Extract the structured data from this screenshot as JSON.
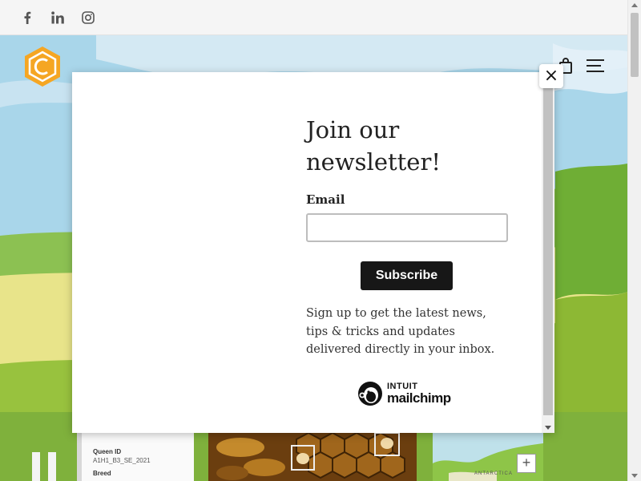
{
  "social": {
    "icons": [
      "facebook-icon",
      "linkedin-icon",
      "instagram-icon"
    ]
  },
  "header": {
    "logo_icon": "hexagon-logo-icon",
    "cart_icon": "shopping-bag-icon",
    "menu_icon": "hamburger-menu-icon"
  },
  "modal": {
    "close_label": "×",
    "title": "Join our newsletter!",
    "email_label": "Email",
    "email_value": "",
    "subscribe_label": "Subscribe",
    "description": "Sign up to get the latest news, tips & tricks and updates delivered directly in your inbox.",
    "badge": {
      "line1": "INTUIT",
      "line2": "mailchimp"
    }
  },
  "cards": {
    "queen": {
      "id_label": "Queen ID",
      "id_value": "A1H1_B3_SE_2021",
      "breed_label": "Breed"
    },
    "map": {
      "zoom_label": "+",
      "region_label": "ANTARCTICA"
    }
  },
  "colors": {
    "sky": "#a9d6ea",
    "logo_orange": "#f5a623",
    "button": "#171717"
  }
}
